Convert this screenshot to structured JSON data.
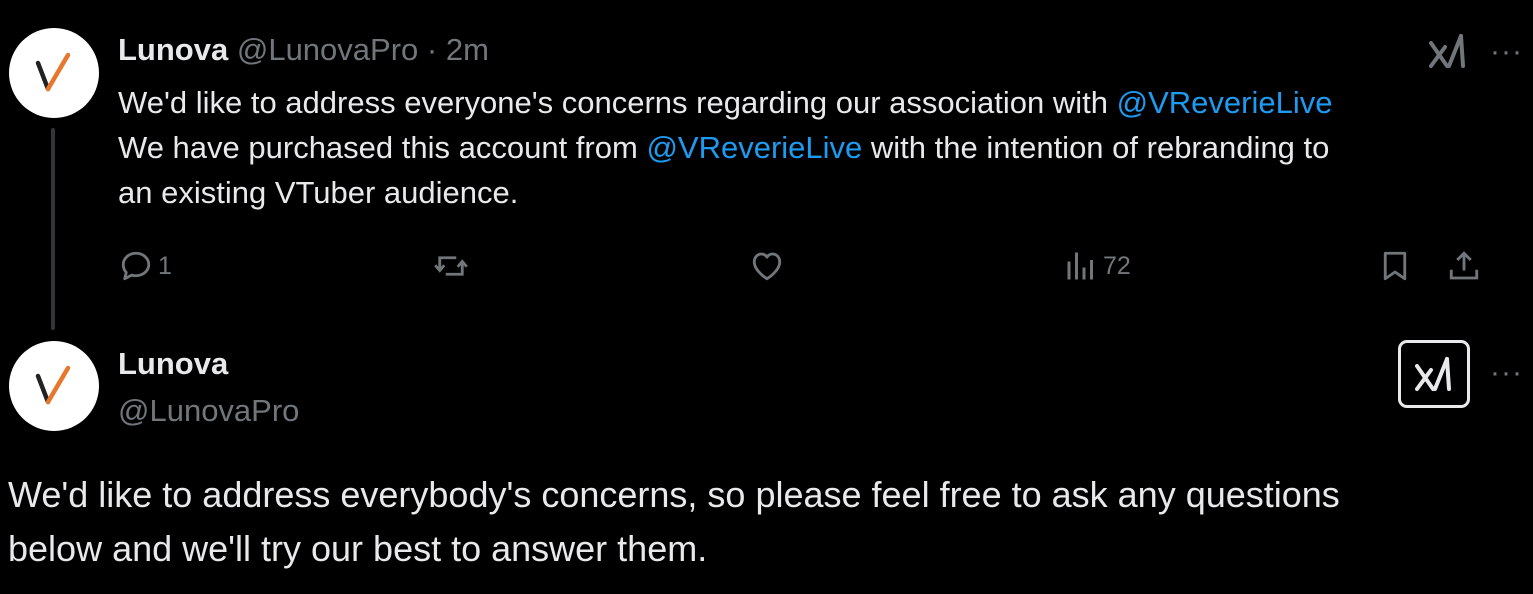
{
  "tweet": {
    "display_name": "Lunova",
    "handle": "@LunovaPro",
    "separator": "·",
    "time": "2m",
    "text_line1_before": "We'd like to address everyone's concerns regarding our association with ",
    "text_line1_mention": "@VReverieLive",
    "text_line2_before": "We have purchased this account from ",
    "text_line2_mention": "@VReverieLive",
    "text_line2_after": " with the intention of rebranding to",
    "text_line3": "an existing VTuber audience.",
    "actions": {
      "reply_count": "1",
      "views_count": "72"
    },
    "more_label": "···",
    "icons": [
      "reply-icon",
      "retweet-icon",
      "like-icon",
      "views-icon",
      "bookmark-icon",
      "share-icon",
      "grok-icon",
      "more-icon"
    ]
  },
  "profile_card": {
    "display_name": "Lunova",
    "handle": "@LunovaPro",
    "more_label": "···",
    "text_line1": "We'd like to address everybody's concerns, so please feel free to ask any questions",
    "text_line2": "below and we'll try our best to answer them."
  },
  "colors": {
    "background": "#000000",
    "text": "#e7e9ea",
    "muted": "#71767b",
    "mention": "#1d9bf0",
    "avatar_accent": "#e8772e"
  }
}
